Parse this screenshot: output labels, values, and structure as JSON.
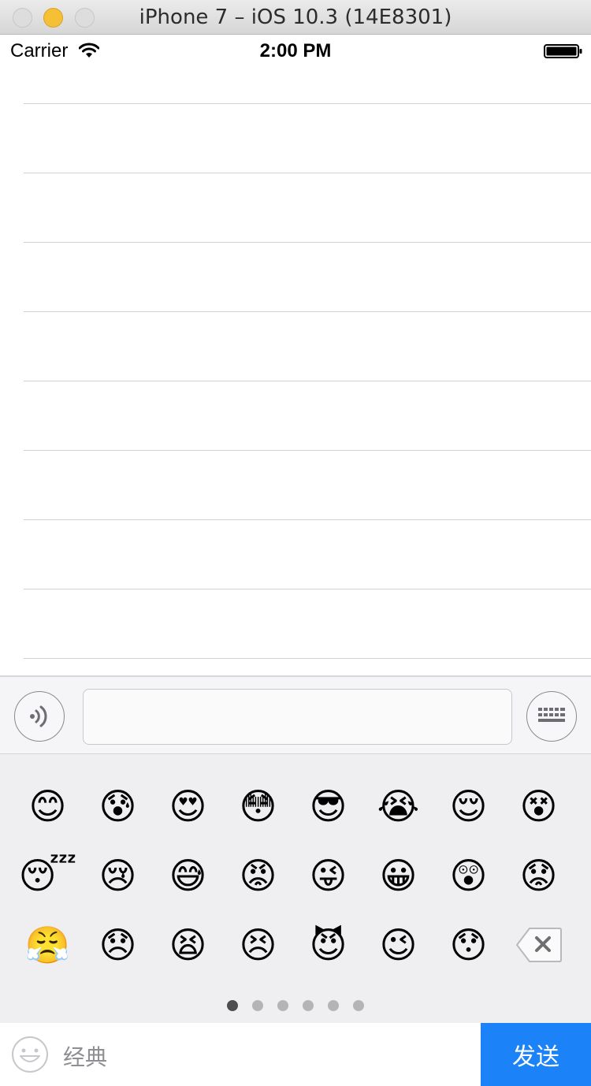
{
  "window": {
    "title": "iPhone 7 – iOS 10.3 (14E8301)"
  },
  "status_bar": {
    "carrier": "Carrier",
    "time": "2:00 PM"
  },
  "table": {
    "row_count": 9
  },
  "toolbar": {
    "input_value": "",
    "input_placeholder": ""
  },
  "emoji_panel": {
    "emojis": [
      "😊",
      "😰",
      "😍",
      "😳",
      "😎",
      "😭",
      "😌",
      "😵",
      "😴",
      "😢",
      "😅",
      "😡",
      "😜",
      "😀",
      "😲",
      "😟",
      "😤",
      "😞",
      "😫",
      "😣",
      "😈",
      "😉",
      "😯"
    ],
    "page_count": 6,
    "active_page": 1
  },
  "bottom_bar": {
    "category_label": "经典",
    "send_label": "发送"
  },
  "colors": {
    "send": "#1b82f7",
    "panel_bg": "#efeff1",
    "active_dot": "#4e4e50",
    "inactive_dot": "#b4b4b6"
  }
}
